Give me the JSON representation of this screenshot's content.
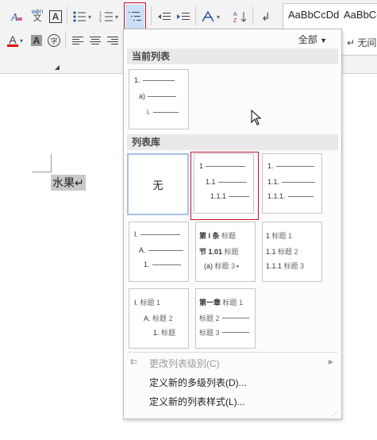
{
  "toolbar": {
    "font_icon_label": "A",
    "pinyin_top": "wén",
    "pinyin_bottom": "文",
    "border_icon_label": "A",
    "font_color_label": "A",
    "highlight_label": "A",
    "char_circle_label": "字",
    "sort_label": "A↓",
    "style1": "AaBbCcDd",
    "style2": "AaBbCc",
    "style2_sub": "↵ 无间"
  },
  "document": {
    "text": "水果↵"
  },
  "panel": {
    "filter_label": "全部",
    "current_list_header": "当前列表",
    "library_header": "列表库",
    "none_label": "无",
    "current_thumb": [
      {
        "num": "1."
      },
      {
        "num": "a)"
      },
      {
        "num": "i."
      }
    ],
    "library": {
      "numeric": [
        "1",
        "1.1",
        "1.1.1"
      ],
      "numeric_dots": [
        "1.",
        "1.1.",
        "1.1.1."
      ],
      "roman_outline": [
        "I.",
        "A.",
        "1."
      ],
      "article_section": [
        {
          "num": "第 I 条",
          "label": "标题"
        },
        {
          "num": "节 1.01",
          "label": "标题"
        },
        {
          "num": "(a)",
          "label": "标题 3"
        }
      ],
      "heading_numeric": [
        {
          "num": "1",
          "label": "标题 1"
        },
        {
          "num": "1.1",
          "label": "标题 2"
        },
        {
          "num": "1.1.1",
          "label": "标题 3"
        }
      ],
      "heading_roman": [
        {
          "num": "I.",
          "label": "标题 1"
        },
        {
          "num": "A.",
          "label": "标题 2"
        },
        {
          "num": "1.",
          "label": "标题"
        }
      ],
      "chapter": [
        {
          "num": "第一章",
          "label": "标题 1"
        },
        {
          "num": "",
          "label": "标题 2"
        },
        {
          "num": "",
          "label": "标题 3"
        }
      ]
    },
    "menu": {
      "change_level": "更改列表级别(C)",
      "define_multilevel": "定义新的多级列表(D)...",
      "define_style": "定义新的列表样式(L)..."
    }
  }
}
